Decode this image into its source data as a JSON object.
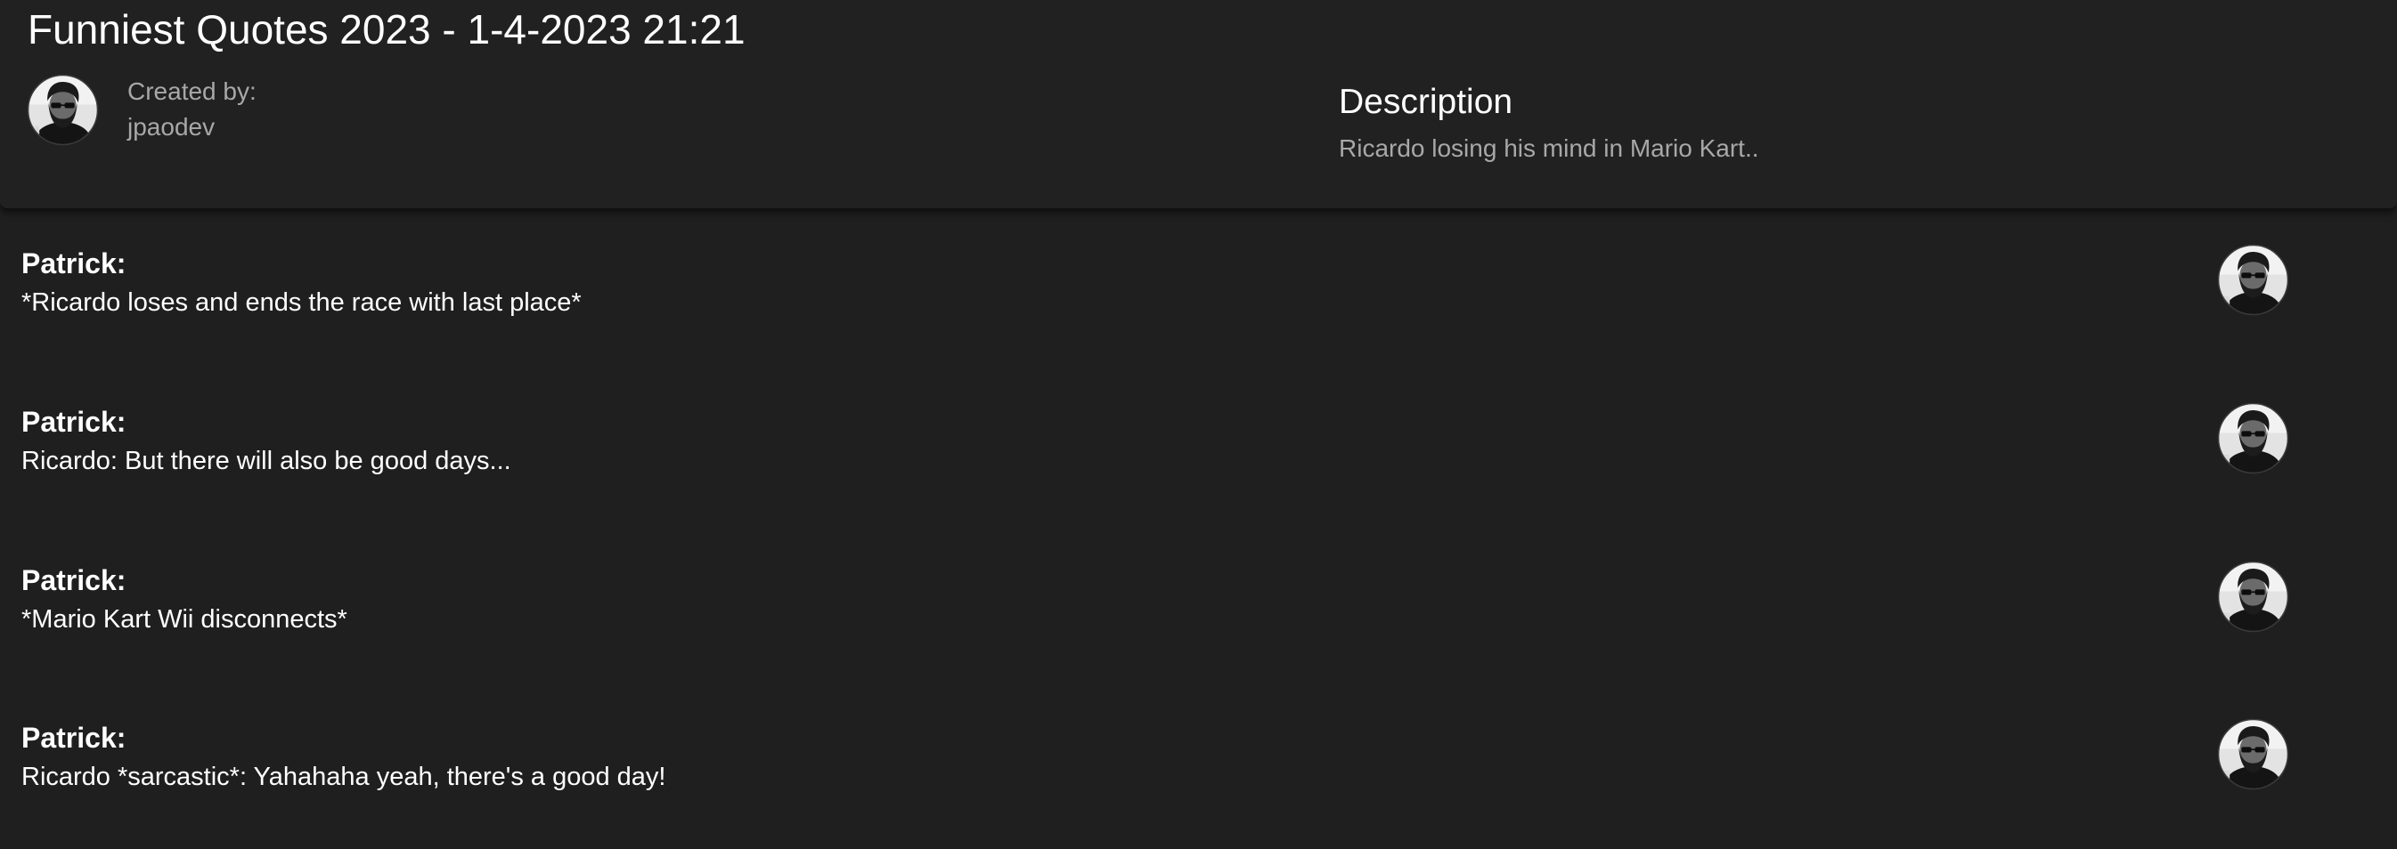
{
  "page": {
    "title": "Funniest Quotes 2023 - 1-4-2023 21:21"
  },
  "creator": {
    "label": "Created by:",
    "name": "jpaodev"
  },
  "description": {
    "title": "Description",
    "text": "Ricardo losing his mind in Mario Kart.."
  },
  "quotes": [
    {
      "author": "Patrick:",
      "text": "*Ricardo loses and ends the race with last place*"
    },
    {
      "author": "Patrick:",
      "text": "Ricardo: But there will also be good days..."
    },
    {
      "author": "Patrick:",
      "text": "*Mario Kart Wii disconnects*"
    },
    {
      "author": "Patrick:",
      "text": "Ricardo *sarcastic*: Yahahaha yeah, there's a good day!"
    }
  ],
  "colors": {
    "background": "#1f1f1f",
    "header_background": "#212121",
    "muted_text": "#a8a8a8",
    "primary_text": "#ffffff"
  },
  "icons": {
    "avatar": "user-avatar-photo"
  }
}
